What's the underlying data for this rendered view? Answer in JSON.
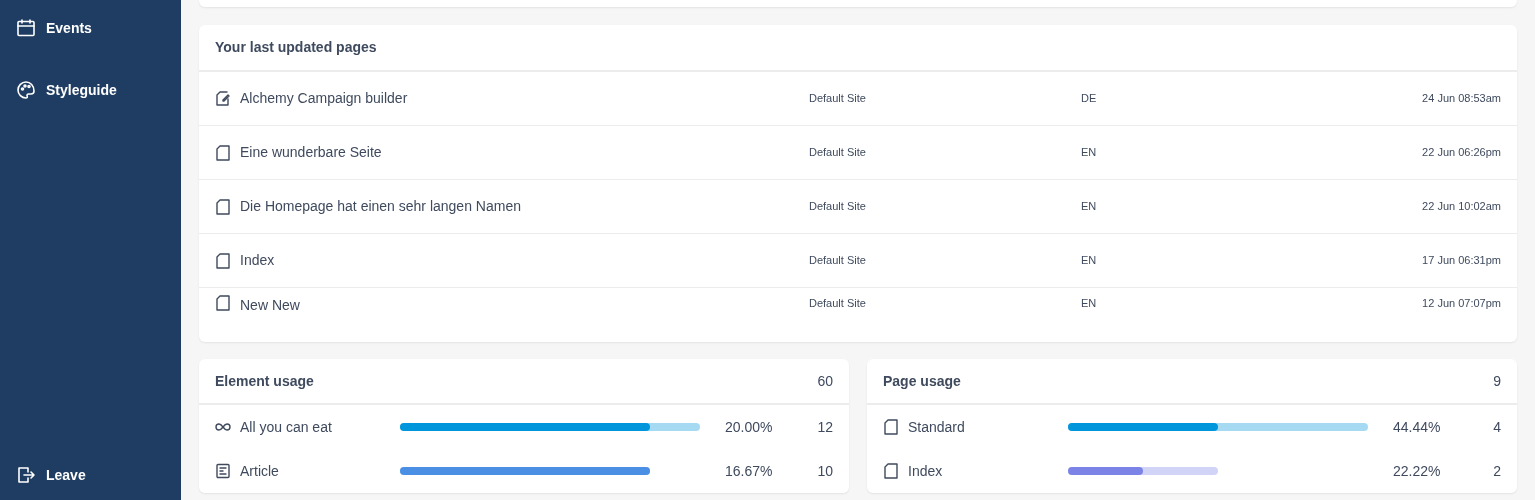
{
  "sidebar": {
    "items": [
      {
        "label": "Events"
      },
      {
        "label": "Styleguide"
      }
    ],
    "footer": {
      "label": "Leave"
    }
  },
  "last_pages": {
    "title": "Your last updated pages",
    "rows": [
      {
        "kind": "edited",
        "name": "Alchemy Campaign builder",
        "site": "Default Site",
        "language": "DE",
        "updated": "24 Jun 08:53am"
      },
      {
        "kind": "page",
        "name": "Eine wunderbare Seite",
        "site": "Default Site",
        "language": "EN",
        "updated": "22 Jun 06:26pm"
      },
      {
        "kind": "page",
        "name": "Die Homepage hat einen sehr langen Namen",
        "site": "Default Site",
        "language": "EN",
        "updated": "22 Jun 10:02am"
      },
      {
        "kind": "page",
        "name": "Index",
        "site": "Default Site",
        "language": "EN",
        "updated": "17 Jun 06:31pm"
      },
      {
        "kind": "page",
        "name": "New New",
        "site": "Default Site",
        "language": "EN",
        "updated": "12 Jun 07:07pm"
      }
    ]
  },
  "element_usage": {
    "title": "Element usage",
    "total": "60",
    "rows": [
      {
        "kind": "infinity",
        "name": "All you can eat",
        "level": 0.833,
        "color": "#0096dc",
        "percent": "20.00%",
        "count": "12"
      },
      {
        "kind": "article",
        "name": "Article",
        "level": 1.0,
        "color": "#4a8fe4",
        "percent": "16.67%",
        "count": "10"
      }
    ]
  },
  "page_usage": {
    "title": "Page usage",
    "total": "9",
    "rows": [
      {
        "kind": "page",
        "name": "Standard",
        "level": 0.5,
        "color": "#0096dc",
        "percent": "44.44%",
        "count": "4"
      },
      {
        "kind": "page",
        "name": "Index",
        "level": 0.5,
        "color": "#7b84e6",
        "percent": "22.22%",
        "count": "2"
      }
    ]
  }
}
